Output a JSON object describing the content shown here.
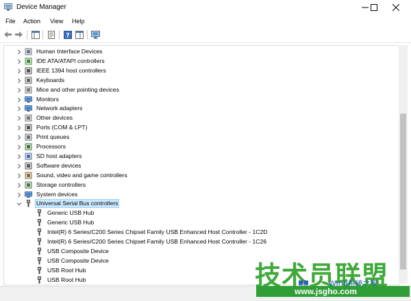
{
  "window": {
    "title": "Device Manager"
  },
  "menu": [
    "File",
    "Action",
    "View",
    "Help"
  ],
  "toolbar": {
    "buttons": [
      "back-icon",
      "forward-icon",
      "properties-list-icon",
      "properties-icon",
      "help-icon",
      "show-hide-pane-icon",
      "computer-monitor-icon"
    ]
  },
  "tree": {
    "items": [
      {
        "label": "Human Interface Devices",
        "icon": "hid-icon",
        "level": 0,
        "expanded": false
      },
      {
        "label": "IDE ATA/ATAPI controllers",
        "icon": "ide-icon",
        "level": 0,
        "expanded": false
      },
      {
        "label": "IEEE 1394 host controllers",
        "icon": "ieee1394-icon",
        "level": 0,
        "expanded": false
      },
      {
        "label": "Keyboards",
        "icon": "keyboard-icon",
        "level": 0,
        "expanded": false
      },
      {
        "label": "Mice and other pointing devices",
        "icon": "mouse-icon",
        "level": 0,
        "expanded": false
      },
      {
        "label": "Monitors",
        "icon": "monitor-icon",
        "level": 0,
        "expanded": false
      },
      {
        "label": "Network adapters",
        "icon": "network-icon",
        "level": 0,
        "expanded": false
      },
      {
        "label": "Other devices",
        "icon": "unknown-device-icon",
        "level": 0,
        "expanded": false
      },
      {
        "label": "Ports (COM & LPT)",
        "icon": "port-icon",
        "level": 0,
        "expanded": false
      },
      {
        "label": "Print queues",
        "icon": "printer-icon",
        "level": 0,
        "expanded": false
      },
      {
        "label": "Processors",
        "icon": "processor-icon",
        "level": 0,
        "expanded": false
      },
      {
        "label": "SD host adapters",
        "icon": "sd-card-icon",
        "level": 0,
        "expanded": false
      },
      {
        "label": "Software devices",
        "icon": "software-device-icon",
        "level": 0,
        "expanded": false
      },
      {
        "label": "Sound, video and game controllers",
        "icon": "sound-icon",
        "level": 0,
        "expanded": false
      },
      {
        "label": "Storage controllers",
        "icon": "storage-icon",
        "level": 0,
        "expanded": false
      },
      {
        "label": "System devices",
        "icon": "system-device-icon",
        "level": 0,
        "expanded": false
      },
      {
        "label": "Universal Serial Bus controllers",
        "icon": "usb-icon",
        "level": 0,
        "expanded": true,
        "selected": true
      },
      {
        "label": "Generic USB Hub",
        "icon": "usb-icon",
        "level": 1
      },
      {
        "label": "Generic USB Hub",
        "icon": "usb-icon",
        "level": 1
      },
      {
        "label": "Intel(R) 6 Series/C200 Series Chipset Family USB Enhanced Host Controller - 1C2D",
        "icon": "usb-icon",
        "level": 1
      },
      {
        "label": "Intel(R) 6 Series/C200 Series Chipset Family USB Enhanced Host Controller - 1C26",
        "icon": "usb-icon",
        "level": 1
      },
      {
        "label": "USB Composite Device",
        "icon": "usb-icon",
        "level": 1
      },
      {
        "label": "USB Composite Device",
        "icon": "usb-icon",
        "level": 1
      },
      {
        "label": "USB Root Hub",
        "icon": "usb-icon",
        "level": 1
      },
      {
        "label": "USB Root Hub",
        "icon": "usb-icon",
        "level": 1
      }
    ]
  },
  "watermark": {
    "chinese": "技术员联盟",
    "small_text": "Win8系统之家",
    "url": "www.jsgho.com"
  },
  "colors": {
    "selection": "#cce8ff",
    "watermark_green": "#3fa93a",
    "watermark_bar": "#2f9e37"
  }
}
